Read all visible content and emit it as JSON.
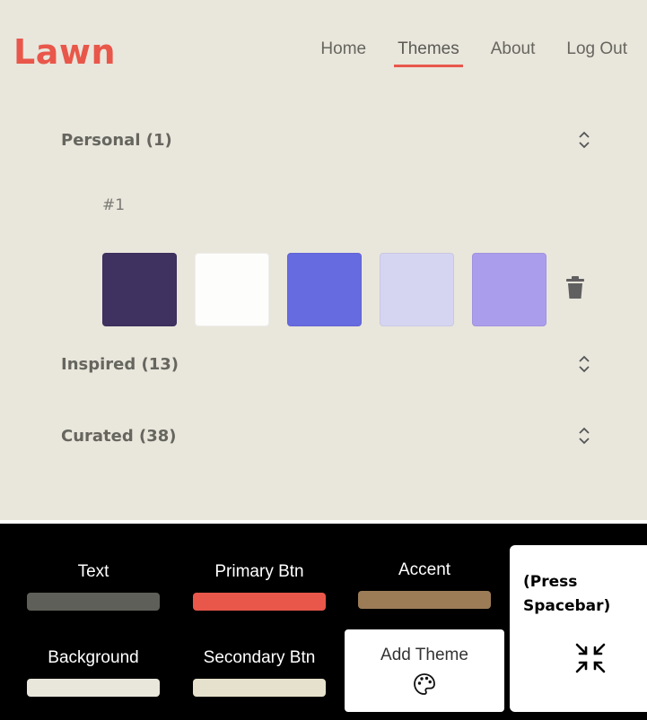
{
  "header": {
    "logo": "Lawn",
    "nav": [
      {
        "label": "Home",
        "active": false
      },
      {
        "label": "Themes",
        "active": true
      },
      {
        "label": "About",
        "active": false
      },
      {
        "label": "Log Out",
        "active": false
      }
    ]
  },
  "sections": {
    "personal": {
      "title": "Personal (1)",
      "icon": "chevron-up-down-icon"
    },
    "inspired": {
      "title": "Inspired (13)",
      "icon": "chevron-up-down-icon"
    },
    "curated": {
      "title": "Curated (38)",
      "icon": "chevron-up-down-icon"
    }
  },
  "personal_theme": {
    "number": "#1",
    "swatches": [
      "#3f3160",
      "#fdfdfb",
      "#676be0",
      "#d5d5f2",
      "#aa9deb"
    ],
    "delete_icon": "trash-icon"
  },
  "panel": {
    "text": {
      "label": "Text",
      "color": "#5f5f5a"
    },
    "primary_btn": {
      "label": "Primary Btn",
      "color": "#e8574a"
    },
    "accent": {
      "label": "Accent",
      "color": "#9c7c57"
    },
    "background": {
      "label": "Background",
      "color": "#e9e6dc"
    },
    "secondary_btn": {
      "label": "Secondary Btn",
      "color": "#e6e1cc"
    },
    "add_theme": {
      "label": "Add Theme",
      "icon": "palette-icon"
    },
    "spacebar": {
      "text": "(Press Spacebar)",
      "icon": "shrink-arrows-icon"
    }
  },
  "colors": {
    "brand": "#e8574a",
    "page_bg": "#e9e6dc",
    "panel_bg": "#000000"
  }
}
